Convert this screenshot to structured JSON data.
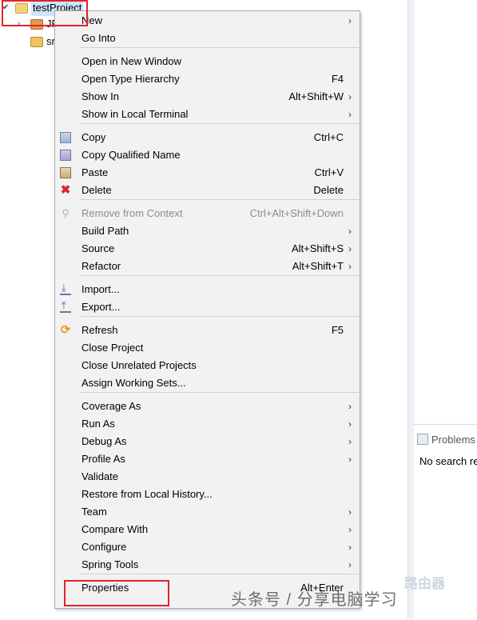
{
  "explorer": {
    "project": "testProject",
    "jre_item": "JR",
    "src_item": "sr"
  },
  "problems": {
    "tab_label": "Problems",
    "message": "No search re"
  },
  "menu": {
    "items": [
      {
        "label": "New",
        "accel": "",
        "submenu": true,
        "icon": "",
        "disabled": false
      },
      {
        "label": "Go Into",
        "accel": "",
        "submenu": false,
        "icon": "",
        "disabled": false
      },
      {
        "label": "Open in New Window",
        "accel": "",
        "submenu": false,
        "icon": "",
        "disabled": false
      },
      {
        "label": "Open Type Hierarchy",
        "accel": "F4",
        "submenu": false,
        "icon": "",
        "disabled": false
      },
      {
        "label": "Show In",
        "accel": "Alt+Shift+W",
        "submenu": true,
        "icon": "",
        "disabled": false
      },
      {
        "label": "Show in Local Terminal",
        "accel": "",
        "submenu": true,
        "icon": "",
        "disabled": false
      },
      {
        "label": "Copy",
        "accel": "Ctrl+C",
        "submenu": false,
        "icon": "copy-icon",
        "disabled": false
      },
      {
        "label": "Copy Qualified Name",
        "accel": "",
        "submenu": false,
        "icon": "copy-qualified-icon",
        "disabled": false
      },
      {
        "label": "Paste",
        "accel": "Ctrl+V",
        "submenu": false,
        "icon": "paste-icon",
        "disabled": false
      },
      {
        "label": "Delete",
        "accel": "Delete",
        "submenu": false,
        "icon": "delete-icon",
        "disabled": false
      },
      {
        "label": "Remove from Context",
        "accel": "Ctrl+Alt+Shift+Down",
        "submenu": false,
        "icon": "remove-context-icon",
        "disabled": true
      },
      {
        "label": "Build Path",
        "accel": "",
        "submenu": true,
        "icon": "",
        "disabled": false
      },
      {
        "label": "Source",
        "accel": "Alt+Shift+S",
        "submenu": true,
        "icon": "",
        "disabled": false
      },
      {
        "label": "Refactor",
        "accel": "Alt+Shift+T",
        "submenu": true,
        "icon": "",
        "disabled": false
      },
      {
        "label": "Import...",
        "accel": "",
        "submenu": false,
        "icon": "import-icon",
        "disabled": false
      },
      {
        "label": "Export...",
        "accel": "",
        "submenu": false,
        "icon": "export-icon",
        "disabled": false
      },
      {
        "label": "Refresh",
        "accel": "F5",
        "submenu": false,
        "icon": "refresh-icon",
        "disabled": false
      },
      {
        "label": "Close Project",
        "accel": "",
        "submenu": false,
        "icon": "",
        "disabled": false
      },
      {
        "label": "Close Unrelated Projects",
        "accel": "",
        "submenu": false,
        "icon": "",
        "disabled": false
      },
      {
        "label": "Assign Working Sets...",
        "accel": "",
        "submenu": false,
        "icon": "",
        "disabled": false
      },
      {
        "label": "Coverage As",
        "accel": "",
        "submenu": true,
        "icon": "",
        "disabled": false
      },
      {
        "label": "Run As",
        "accel": "",
        "submenu": true,
        "icon": "",
        "disabled": false
      },
      {
        "label": "Debug As",
        "accel": "",
        "submenu": true,
        "icon": "",
        "disabled": false
      },
      {
        "label": "Profile As",
        "accel": "",
        "submenu": true,
        "icon": "",
        "disabled": false
      },
      {
        "label": "Validate",
        "accel": "",
        "submenu": false,
        "icon": "",
        "disabled": false
      },
      {
        "label": "Restore from Local History...",
        "accel": "",
        "submenu": false,
        "icon": "",
        "disabled": false
      },
      {
        "label": "Team",
        "accel": "",
        "submenu": true,
        "icon": "",
        "disabled": false
      },
      {
        "label": "Compare With",
        "accel": "",
        "submenu": true,
        "icon": "",
        "disabled": false
      },
      {
        "label": "Configure",
        "accel": "",
        "submenu": true,
        "icon": "",
        "disabled": false
      },
      {
        "label": "Spring Tools",
        "accel": "",
        "submenu": true,
        "icon": "",
        "disabled": false
      },
      {
        "label": "Properties",
        "accel": "Alt+Enter",
        "submenu": false,
        "icon": "",
        "disabled": false
      }
    ]
  },
  "submenu_arrow": "›",
  "watermark": "头条号 / 分享电脑学习",
  "watermark_logo": "路由器",
  "colors": {
    "highlight_box": "#e0232c",
    "menu_bg": "#f2f2f2",
    "selection": "#cde6f7"
  }
}
